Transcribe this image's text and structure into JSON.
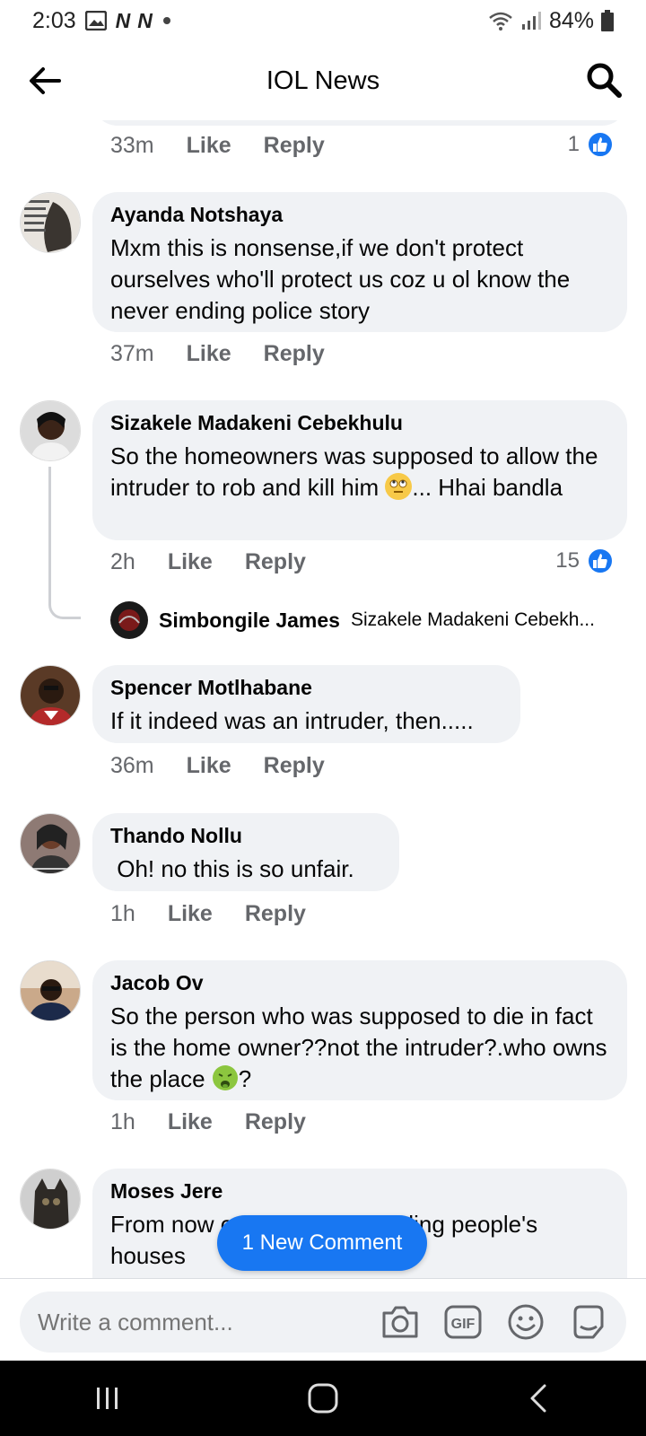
{
  "status": {
    "time": "2:03",
    "battery": "84%"
  },
  "header": {
    "title": "IOL News"
  },
  "top_meta": {
    "time": "33m",
    "like": "Like",
    "reply": "Reply",
    "count": "1"
  },
  "comments": [
    {
      "name": "Ayanda Notshaya",
      "text": "Mxm this is nonsense,if we don't protect ourselves who'll protect us coz u ol know the never ending police story",
      "time": "37m",
      "like": "Like",
      "reply": "Reply"
    },
    {
      "name": "Sizakele Madakeni Cebekhulu",
      "text_a": "So the homeowners was supposed to allow the intruder to rob and kill him ",
      "text_b": "... Hhai bandla",
      "time": "2h",
      "like": "Like",
      "reply": "Reply",
      "count": "15",
      "reply_preview": {
        "name": "Simbongile James",
        "text": "Sizakele Madakeni Cebekh..."
      }
    },
    {
      "name": "Spencer Motlhabane",
      "text": "If it indeed was an intruder, then.....",
      "time": "36m",
      "like": "Like",
      "reply": "Reply"
    },
    {
      "name": "Thando Nollu",
      "text": " Oh! no this is so unfair.",
      "time": "1h",
      "like": "Like",
      "reply": "Reply"
    },
    {
      "name": "Jacob Ov",
      "text_a": "So the person who was supposed to die in fact is the home owner??not the intruder?.who owns the place ",
      "text_b": "?",
      "time": "1h",
      "like": "Like",
      "reply": "Reply"
    },
    {
      "name": "Moses Jere",
      "text": "From now on I will stop intruding people's houses"
    }
  ],
  "new_comment": "1 New Comment",
  "composer": {
    "placeholder": "Write a comment..."
  },
  "colors": {
    "accent": "#1877f2",
    "bubble": "#f0f2f5",
    "meta": "#65676b"
  }
}
